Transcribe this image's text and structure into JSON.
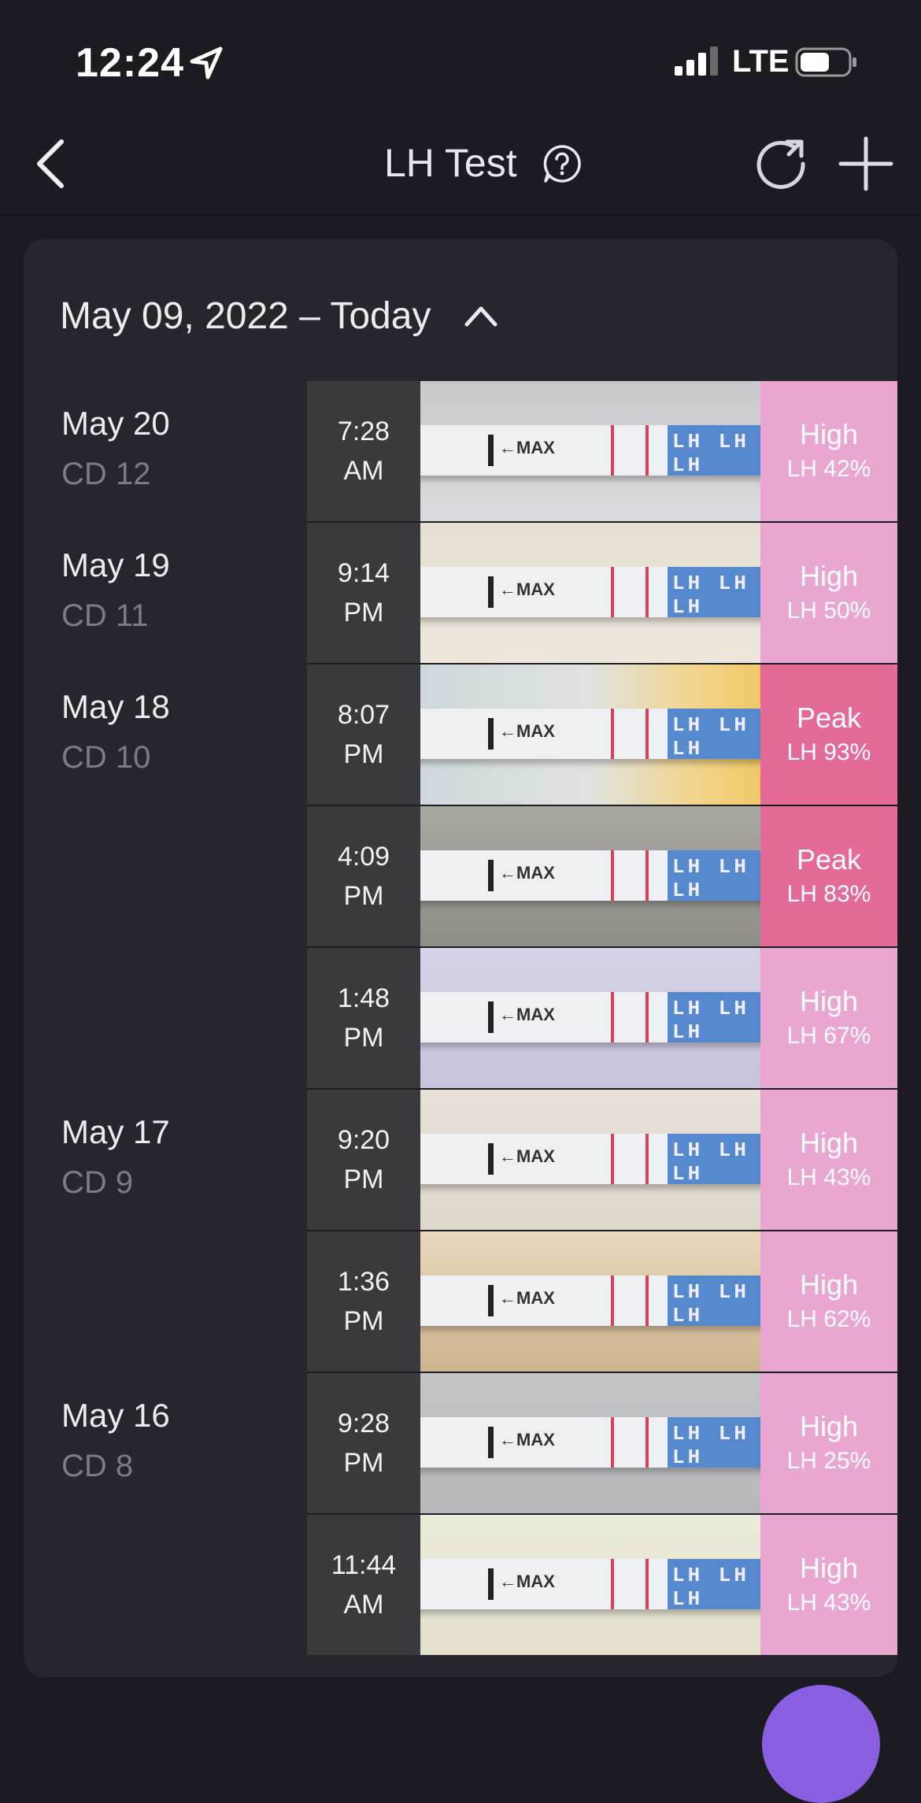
{
  "status_bar": {
    "time": "12:24",
    "network": "LTE"
  },
  "nav": {
    "title": "LH Test"
  },
  "date_range": {
    "label": "May 09, 2022 – Today"
  },
  "colors": {
    "high": "#e9a6d0",
    "peak": "#e46a98",
    "background": "#1c1b21",
    "card": "#27262c"
  },
  "days": [
    {
      "date": "May 20",
      "cd": "CD 12"
    },
    {
      "date": "May 19",
      "cd": "CD 11"
    },
    {
      "date": "May 18",
      "cd": "CD 10"
    },
    {
      "date": "May 17",
      "cd": "CD 9"
    },
    {
      "date": "May 16",
      "cd": "CD 8"
    }
  ],
  "tests": [
    {
      "time_line1": "7:28",
      "time_line2": "AM",
      "level": "High",
      "lh": "LH 42%"
    },
    {
      "time_line1": "9:14",
      "time_line2": "PM",
      "level": "High",
      "lh": "LH 50%"
    },
    {
      "time_line1": "8:07",
      "time_line2": "PM",
      "level": "Peak",
      "lh": "LH 93%"
    },
    {
      "time_line1": "4:09",
      "time_line2": "PM",
      "level": "Peak",
      "lh": "LH 83%"
    },
    {
      "time_line1": "1:48",
      "time_line2": "PM",
      "level": "High",
      "lh": "LH 67%"
    },
    {
      "time_line1": "9:20",
      "time_line2": "PM",
      "level": "High",
      "lh": "LH 43%"
    },
    {
      "time_line1": "1:36",
      "time_line2": "PM",
      "level": "High",
      "lh": "LH 62%"
    },
    {
      "time_line1": "9:28",
      "time_line2": "PM",
      "level": "High",
      "lh": "LH 25%"
    },
    {
      "time_line1": "11:44",
      "time_line2": "AM",
      "level": "High",
      "lh": "LH 43%"
    }
  ],
  "strip_text": {
    "max": "←MAX",
    "handle": "LH LH LH"
  }
}
